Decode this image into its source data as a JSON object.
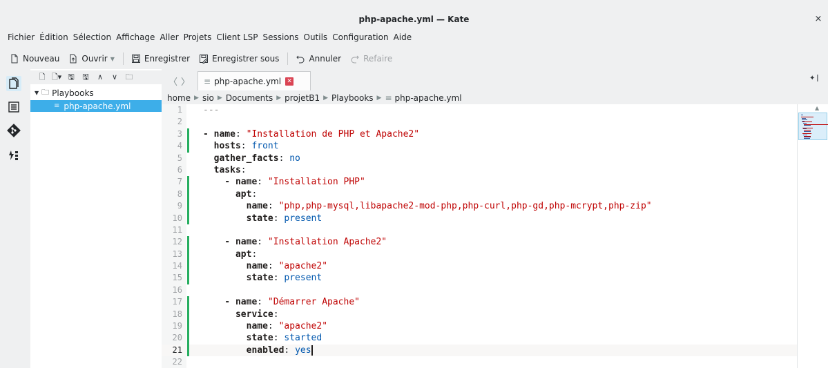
{
  "window": {
    "title": "php-apache.yml — Kate",
    "close_glyph": "×"
  },
  "menu": [
    "Fichier",
    "Édition",
    "Sélection",
    "Affichage",
    "Aller",
    "Projets",
    "Client LSP",
    "Sessions",
    "Outils",
    "Configuration",
    "Aide"
  ],
  "toolbar": {
    "new": "Nouveau",
    "open": "Ouvrir",
    "save": "Enregistrer",
    "save_as": "Enregistrer sous",
    "undo": "Annuler",
    "redo": "Refaire"
  },
  "tree": {
    "folder": "Playbooks",
    "file": "php-apache.yml"
  },
  "tab": {
    "label": "php-apache.yml"
  },
  "breadcrumb": [
    "home",
    "sio",
    "Documents",
    "projetB1",
    "Playbooks",
    "php-apache.yml"
  ],
  "editor": {
    "current_line": 21,
    "lines": [
      [
        {
          "t": "---",
          "c": "d"
        }
      ],
      [],
      [
        {
          "t": "- ",
          "c": "k"
        },
        {
          "t": "name",
          "c": "k"
        },
        {
          "t": ": ",
          "c": ""
        },
        {
          "t": "\"Installation de PHP et Apache2\"",
          "c": "s"
        }
      ],
      [
        {
          "t": "  hosts",
          "c": "k"
        },
        {
          "t": ": ",
          "c": ""
        },
        {
          "t": "front",
          "c": "v"
        }
      ],
      [
        {
          "t": "  gather_facts",
          "c": "k"
        },
        {
          "t": ": ",
          "c": ""
        },
        {
          "t": "no",
          "c": "v"
        }
      ],
      [
        {
          "t": "  tasks",
          "c": "k"
        },
        {
          "t": ":",
          "c": ""
        }
      ],
      [
        {
          "t": "    - ",
          "c": "k"
        },
        {
          "t": "name",
          "c": "k"
        },
        {
          "t": ": ",
          "c": ""
        },
        {
          "t": "\"Installation PHP\"",
          "c": "s"
        }
      ],
      [
        {
          "t": "      apt",
          "c": "k"
        },
        {
          "t": ":",
          "c": ""
        }
      ],
      [
        {
          "t": "        name",
          "c": "k"
        },
        {
          "t": ": ",
          "c": ""
        },
        {
          "t": "\"php,php-mysql,libapache2-mod-php,php-curl,php-gd,php-mcrypt,php-zip\"",
          "c": "s"
        }
      ],
      [
        {
          "t": "        state",
          "c": "k"
        },
        {
          "t": ": ",
          "c": ""
        },
        {
          "t": "present",
          "c": "v"
        }
      ],
      [],
      [
        {
          "t": "    - ",
          "c": "k"
        },
        {
          "t": "name",
          "c": "k"
        },
        {
          "t": ": ",
          "c": ""
        },
        {
          "t": "\"Installation Apache2\"",
          "c": "s"
        }
      ],
      [
        {
          "t": "      apt",
          "c": "k"
        },
        {
          "t": ":",
          "c": ""
        }
      ],
      [
        {
          "t": "        name",
          "c": "k"
        },
        {
          "t": ": ",
          "c": ""
        },
        {
          "t": "\"apache2\"",
          "c": "s"
        }
      ],
      [
        {
          "t": "        state",
          "c": "k"
        },
        {
          "t": ": ",
          "c": ""
        },
        {
          "t": "present",
          "c": "v"
        }
      ],
      [],
      [
        {
          "t": "    - ",
          "c": "k"
        },
        {
          "t": "name",
          "c": "k"
        },
        {
          "t": ": ",
          "c": ""
        },
        {
          "t": "\"Démarrer Apache\"",
          "c": "s"
        }
      ],
      [
        {
          "t": "      service",
          "c": "k"
        },
        {
          "t": ":",
          "c": ""
        }
      ],
      [
        {
          "t": "        name",
          "c": "k"
        },
        {
          "t": ": ",
          "c": ""
        },
        {
          "t": "\"apache2\"",
          "c": "s"
        }
      ],
      [
        {
          "t": "        state",
          "c": "k"
        },
        {
          "t": ": ",
          "c": ""
        },
        {
          "t": "started",
          "c": "v"
        }
      ],
      [
        {
          "t": "        enabled",
          "c": "k"
        },
        {
          "t": ": ",
          "c": ""
        },
        {
          "t": "yes",
          "c": "v"
        }
      ],
      []
    ],
    "modified_lines": [
      3,
      4,
      7,
      8,
      9,
      10,
      12,
      13,
      14,
      15,
      17,
      18,
      19,
      20,
      21
    ]
  },
  "colors": {
    "accent": "#3daee9",
    "modified": "#27ae60",
    "tab_close": "#da4453"
  }
}
